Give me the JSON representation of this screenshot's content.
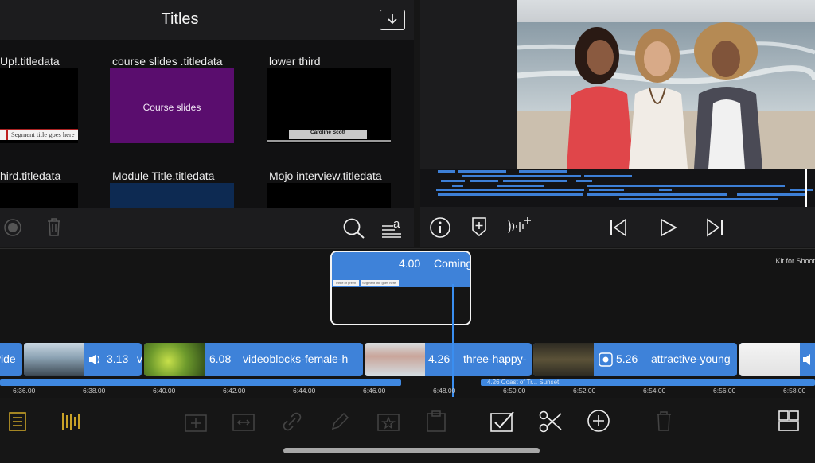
{
  "titles_panel": {
    "title": "Titles",
    "tiles": [
      {
        "label": "Up!.titledata",
        "thumb_text": "Segment title goes here"
      },
      {
        "label": "course slides .titledata",
        "thumb_text": "Course slides"
      },
      {
        "label": "lower third",
        "thumb_text": "Caroline Scott"
      },
      {
        "label": "hird.titledata"
      },
      {
        "label": "Module Title.titledata"
      },
      {
        "label": "Mojo interview.titledata"
      }
    ]
  },
  "title_clip": {
    "duration": "4.00",
    "name": "Coming",
    "mini_labels": [
      "Three of green",
      "Segment title goes here"
    ]
  },
  "timeline": {
    "kit_label": "Kit for Shoot",
    "clips": [
      {
        "duration": "",
        "name": "vide"
      },
      {
        "duration": "3.13",
        "name": "v"
      },
      {
        "duration": "6.08",
        "name": "videoblocks-female-h"
      },
      {
        "duration": "4.26",
        "name": "three-happy-"
      },
      {
        "duration": "5.26",
        "name": "attractive-young"
      }
    ],
    "audio_label": "4.26 Coast of Tr... Sunset",
    "ruler": [
      "6:36.00",
      "6:38.00",
      "6:40.00",
      "6:42.00",
      "6:44.00",
      "6:46.00",
      "6:48.00",
      "6:50.00",
      "6:52.00",
      "6:54.00",
      "6:56.00",
      "6:58.00"
    ]
  },
  "colors": {
    "accent_blue": "#3e82d9",
    "gold_icons": "#c9a227",
    "panel_bg": "#1c1c1e"
  },
  "icons": {
    "titles_toolbar": [
      "record-icon",
      "trash-icon",
      "search-icon",
      "font-size-icon"
    ],
    "viewer_toolbar": [
      "info-icon",
      "add-marker-icon",
      "audio-add-icon",
      "skip-back-icon",
      "play-icon",
      "skip-forward-icon"
    ],
    "bottom_toolbar": [
      "project-list-icon",
      "tracks-icon",
      "add-clip-icon",
      "transition-icon",
      "link-icon",
      "pencil-icon",
      "star-clip-icon",
      "clipboard-icon",
      "select-icon",
      "scissors-icon",
      "add-icon",
      "delete-icon",
      "layout-icon"
    ]
  }
}
